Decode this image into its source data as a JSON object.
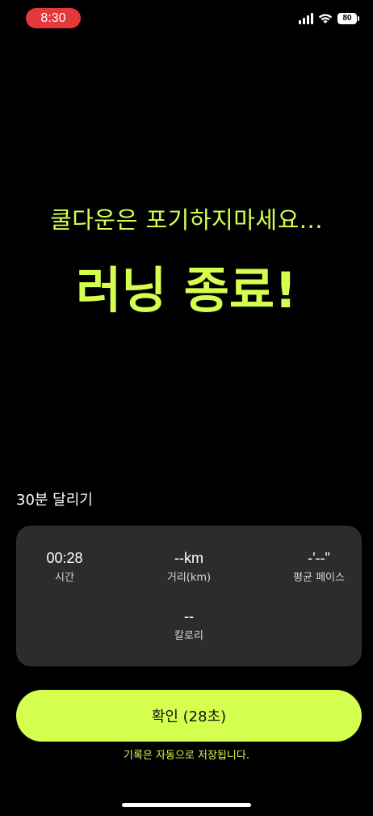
{
  "status_bar": {
    "time": "8:30",
    "battery": "80",
    "icons": [
      "signal-icon",
      "wifi-icon",
      "battery-icon"
    ]
  },
  "main": {
    "subtitle": "쿨다운은 포기하지마세요...",
    "headline": "러닝 종료!"
  },
  "workout": {
    "title": "30분 달리기",
    "stats": [
      {
        "value": "00:28",
        "label": "시간"
      },
      {
        "value": "--km",
        "label": "거리(km)"
      },
      {
        "value": "-'--\"",
        "label": "평균 페이스"
      },
      {
        "value": "--",
        "label": "칼로리"
      }
    ]
  },
  "actions": {
    "confirm_label": "확인 (28초)",
    "auto_save_note": "기록은 자동으로 저장됩니다."
  },
  "colors": {
    "accent": "#d4ff4f",
    "background": "#000000",
    "card": "#2c2c2e",
    "time_pill": "#e5383b"
  }
}
